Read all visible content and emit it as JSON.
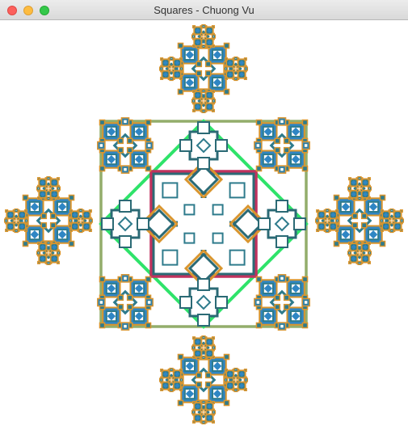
{
  "window": {
    "title": "Squares - Chuong Vu",
    "controls": {
      "close_icon": "close-icon",
      "minimize_icon": "minimize-icon",
      "maximize_icon": "maximize-icon"
    }
  },
  "colors": {
    "background": "#ffffff",
    "outer_square": "#93ad6b",
    "diamond": "#2fe36a",
    "inner_square": "#c0325e",
    "teal": "#2e7b8c",
    "orange": "#d9952e",
    "blue": "#2f86c4",
    "dark_teal": "#2b6a75"
  }
}
